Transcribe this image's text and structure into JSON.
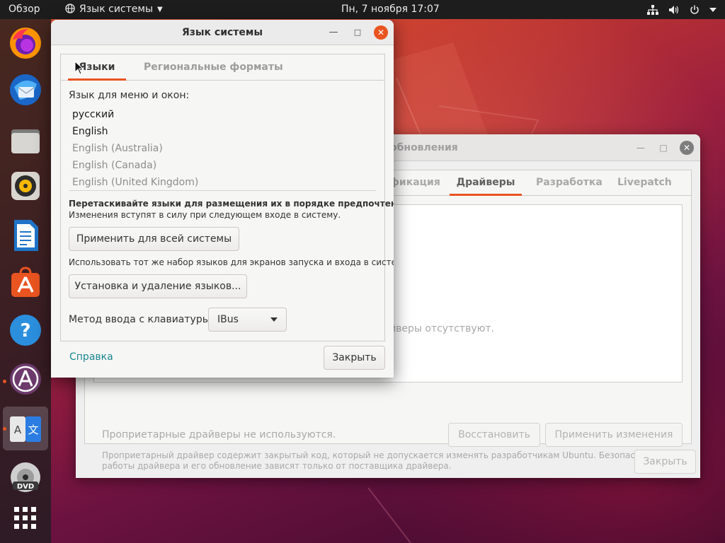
{
  "top_panel": {
    "activities": "Обзор",
    "app_menu": "Язык системы",
    "clock": "Пн, 7 ноября  17:07",
    "tray_icons": [
      "network-icon",
      "volume-icon",
      "power-icon",
      "chevron-down-icon"
    ]
  },
  "dock": {
    "apps": [
      "firefox",
      "thunderbird",
      "files",
      "rhythmbox",
      "libreoffice-writer",
      "software",
      "help",
      "software-updater",
      "language-support",
      "dvd",
      "show-applications"
    ]
  },
  "background_window": {
    "title": "обновления",
    "tabs": [
      "фикация",
      "Драйверы",
      "Разработка",
      "Livepatch"
    ],
    "active_tab": "Драйверы",
    "empty_message": "йверы отсутствуют.",
    "status": "Проприетарные драйверы не используются.",
    "revert_label": "Восстановить",
    "apply_label": "Применить изменения",
    "info": "Проприетарный драйвер содержит закрытый код, который не допускается изменять разработчикам Ubuntu. Безопасность работы драйвера и его обновление зависят только от поставщика драйвера.",
    "close_label": "Закрыть"
  },
  "dialog": {
    "title": "Язык системы",
    "tabs": {
      "languages": "Языки",
      "formats": "Региональные форматы"
    },
    "language_heading": "Язык для меню и окон:",
    "languages": [
      {
        "label": "русский",
        "active": true
      },
      {
        "label": "English",
        "active": true
      },
      {
        "label": "English (Australia)",
        "active": false
      },
      {
        "label": "English (Canada)",
        "active": false
      },
      {
        "label": "English (United Kingdom)",
        "active": false
      }
    ],
    "drag_hint": "Перетаскивайте языки для размещения их в порядке предпочтения.",
    "restart_hint": "Изменения вступят в силу при следующем входе в систему.",
    "apply_system_label": "Применить для всей системы",
    "same_set_hint": "Использовать тот же набор языков для экранов запуска и входа в систему.",
    "install_label": "Установка и удаление языков...",
    "input_method_label": "Метод ввода с клавиатуры:",
    "input_method_value": "IBus",
    "help_label": "Справка",
    "close_label": "Закрыть"
  },
  "colors": {
    "accent": "#e95420",
    "link": "#19878f",
    "panel": "#1d1d1d"
  }
}
